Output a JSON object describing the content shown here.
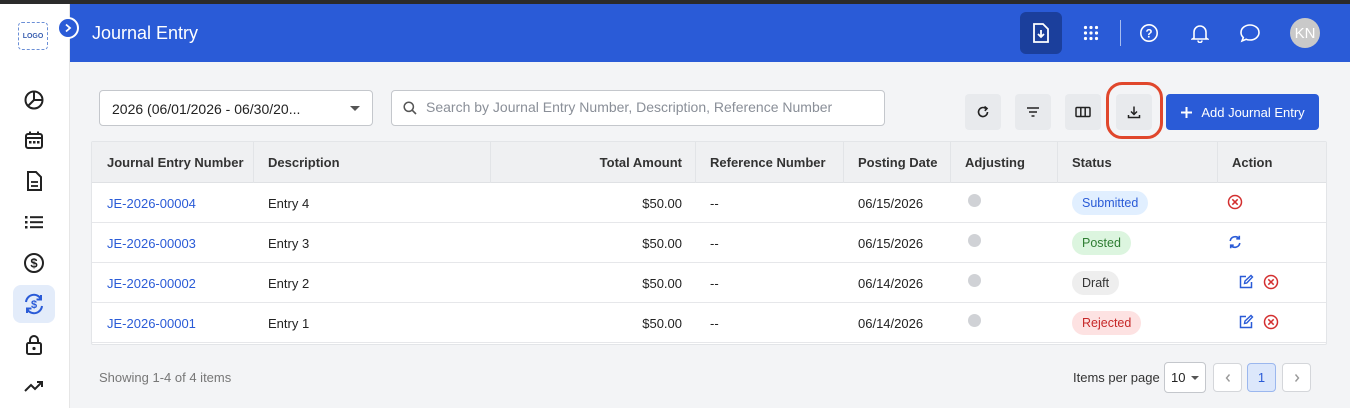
{
  "sidebar": {
    "logo_text": "LOGO",
    "icons": [
      "dashboard-icon",
      "calendar-icon",
      "document-icon",
      "list-icon",
      "dollar-icon",
      "currency-exchange-icon",
      "lock-icon",
      "trending-icon"
    ],
    "active_icon": "currency-exchange-icon"
  },
  "header": {
    "title": "Journal Entry",
    "avatar_initials": "KN",
    "icons": [
      "download-file-icon",
      "apps-grid-icon",
      "help-icon",
      "bell-icon",
      "chat-icon"
    ]
  },
  "toolbar": {
    "year_select": "2026 (06/01/2026 - 06/30/20...",
    "search_placeholder": "Search by Journal Entry Number, Description, Reference Number",
    "search_value": "",
    "add_label": "Add Journal Entry",
    "tool_icons": [
      "refresh-icon",
      "filter-icon",
      "columns-icon",
      "download-icon"
    ]
  },
  "table": {
    "columns": [
      "Journal Entry Number",
      "Description",
      "Total Amount",
      "Reference Number",
      "Posting Date",
      "Adjusting",
      "Status",
      "Action"
    ],
    "rows": [
      {
        "number": "JE-2026-00004",
        "description": "Entry 4",
        "amount": "$50.00",
        "reference": "--",
        "date": "06/15/2026",
        "status": "Submitted",
        "actions": [
          "cancel-icon"
        ]
      },
      {
        "number": "JE-2026-00003",
        "description": "Entry 3",
        "amount": "$50.00",
        "reference": "--",
        "date": "06/15/2026",
        "status": "Posted",
        "actions": [
          "reverse-icon"
        ]
      },
      {
        "number": "JE-2026-00002",
        "description": "Entry 2",
        "amount": "$50.00",
        "reference": "--",
        "date": "06/14/2026",
        "status": "Draft",
        "actions": [
          "edit-icon",
          "cancel-icon"
        ]
      },
      {
        "number": "JE-2026-00001",
        "description": "Entry 1",
        "amount": "$50.00",
        "reference": "--",
        "date": "06/14/2026",
        "status": "Rejected",
        "actions": [
          "edit-icon",
          "cancel-icon"
        ]
      }
    ]
  },
  "status_colors": {
    "Submitted": {
      "bg": "#e1efff",
      "fg": "#2a5bd7"
    },
    "Posted": {
      "bg": "#dcf5df",
      "fg": "#2e7d32"
    },
    "Draft": {
      "bg": "#eeeeee",
      "fg": "#333333"
    },
    "Rejected": {
      "bg": "#fde2e2",
      "fg": "#c62828"
    }
  },
  "footer": {
    "showing": "Showing 1-4 of 4 items",
    "items_per_page_label": "Items per page",
    "items_per_page": "10",
    "current_page": "1"
  },
  "colors": {
    "brand": "#2a5bd7",
    "highlight": "#e0472c"
  }
}
